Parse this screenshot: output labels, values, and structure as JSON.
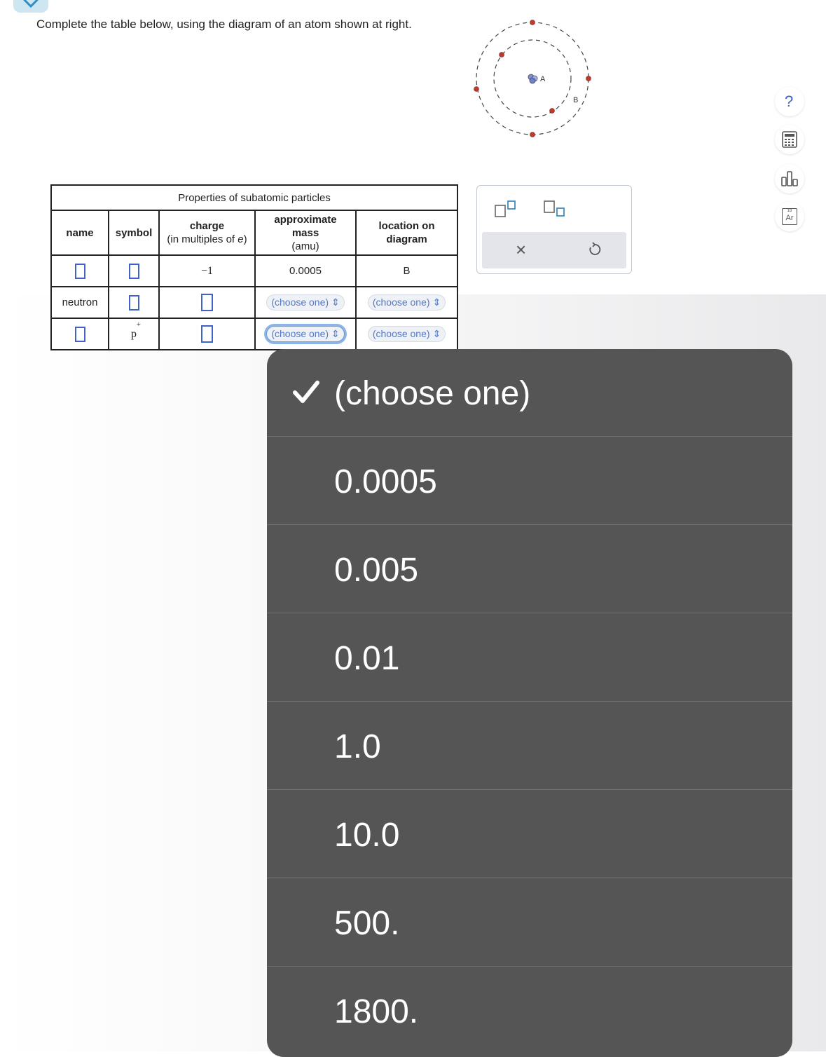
{
  "prompt": "Complete the table below, using the diagram of an atom shown at right.",
  "atom_diagram": {
    "label_a": "A",
    "label_b": "B"
  },
  "table": {
    "caption": "Properties of subatomic particles",
    "headers": {
      "name": "name",
      "symbol": "symbol",
      "charge_main": "charge",
      "charge_sub_prefix": "(in multiples of ",
      "charge_sub_var": "e",
      "charge_sub_suffix": ")",
      "mass_main": "approximate mass",
      "mass_sub": "(amu)",
      "location": "location on diagram"
    },
    "rows": [
      {
        "name": "",
        "symbol": "",
        "charge": "−1",
        "mass": "0.0005",
        "location": "B"
      },
      {
        "name": "neutron",
        "symbol": "",
        "charge": "",
        "mass": "(choose one)",
        "location": "(choose one)"
      },
      {
        "name": "",
        "symbol": "p",
        "symbol_sup": "+",
        "charge": "",
        "mass": "(choose one)",
        "location": "(choose one)"
      }
    ]
  },
  "palette": {
    "clear_symbol": "×"
  },
  "side_tools": {
    "help": "?",
    "periodic_number": "18",
    "periodic_symbol": "Ar"
  },
  "dropdown": {
    "options": [
      "(choose one)",
      "0.0005",
      "0.005",
      "0.01",
      "1.0",
      "10.0",
      "500.",
      "1800."
    ],
    "selected": "(choose one)"
  }
}
